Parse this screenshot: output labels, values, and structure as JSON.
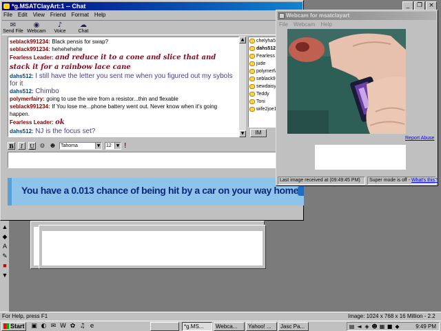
{
  "chat_window": {
    "title": "*g.MSATClayArt:1 -- Chat",
    "menu": [
      "File",
      "Edit",
      "View",
      "Friend",
      "Format",
      "Help"
    ],
    "toolbar": [
      "Send File",
      "Webcam",
      "Voice",
      "Chat"
    ],
    "messages": [
      {
        "who": "seblack991234:",
        "text": "Black pensis for swap?",
        "style": "small",
        "wcls": "w-seblack"
      },
      {
        "who": "seblack991234:",
        "text": "hehehehehe",
        "style": "small",
        "wcls": "w-seblack"
      },
      {
        "who": "Fearless Leader:",
        "text": "and reduce it to a cone and slice that and stack it for a rainbow lace cane",
        "style": "fearless",
        "wcls": "w-fearless"
      },
      {
        "who": "dahs512:",
        "text": "I still have the letter you sent me when you figured out my sybols for it",
        "style": "dahs",
        "wcls": "w-dahs"
      },
      {
        "who": "dahs512:",
        "text": "Chimbo",
        "style": "dahs",
        "wcls": "w-dahs"
      },
      {
        "who": "polymerfairy:",
        "text": "going to use the wire from a resistor...thin and flexable",
        "style": "small",
        "wcls": "w-poly"
      },
      {
        "who": "seblack991234:",
        "text": "If You lose me...phone battery went out. Never know when it's going happen.",
        "style": "small",
        "wcls": "w-seblack"
      },
      {
        "who": "Fearless Leader:",
        "text": "ok",
        "style": "fearless",
        "wcls": "w-fearless"
      },
      {
        "who": "dahs512:",
        "text": "NJ is the focus set?",
        "style": "dahs",
        "wcls": "w-dahs"
      }
    ],
    "contacts": [
      {
        "name": "chelyha5",
        "bold": false
      },
      {
        "name": "dahs512",
        "bold": true
      },
      {
        "name": "Fearless L",
        "bold": false
      },
      {
        "name": "jude",
        "bold": false
      },
      {
        "name": "polymerfa",
        "bold": false
      },
      {
        "name": "seblack99",
        "bold": false
      },
      {
        "name": "sewdaisy",
        "bold": false
      },
      {
        "name": "Teddy",
        "bold": false
      },
      {
        "name": "Toni",
        "bold": false
      },
      {
        "name": "wife2joe1",
        "bold": false
      }
    ],
    "im_button": "IM",
    "format": {
      "bold": "B",
      "italic": "I",
      "underline": "U",
      "font": "Tahoma",
      "size": "12"
    },
    "ad_text": "You have a 0.013 chance of being hit by a car on your way home."
  },
  "webcam_window": {
    "title": "Webcam for msatclayart",
    "menu": [
      "File",
      "Webcam",
      "Help"
    ],
    "report_abuse": "Report Abuse",
    "last_received": "Last image received at (09:49:45 PM)",
    "super_mode": "Super mode is off -",
    "whats_this": "What's this?"
  },
  "status_bar": {
    "help": "For Help, press F1",
    "image_info": "Image:  1024 x 768 x 16 Million - 2.2 MBytes"
  },
  "taskbar": {
    "start": "Start",
    "tasks": [
      {
        "label": "*g.MS...",
        "active": true
      },
      {
        "label": "Webca...",
        "active": false
      },
      {
        "label": "Yahoo! ...",
        "active": false
      },
      {
        "label": "Jasc Pa...",
        "active": false
      }
    ],
    "clock": "9:49 PM"
  }
}
